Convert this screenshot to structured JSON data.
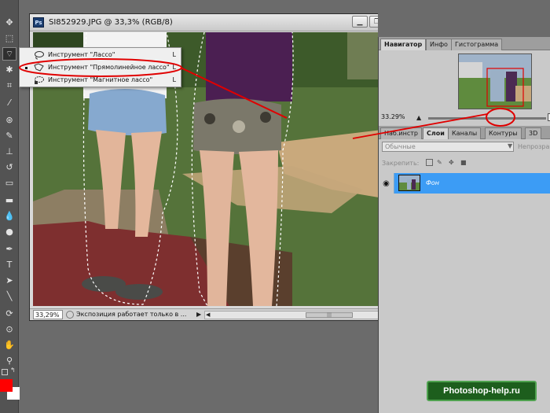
{
  "document": {
    "title": "SI852929.JPG @ 33,3% (RGB/8)",
    "app_badge": "Ps",
    "zoom": "33,29%",
    "status": "Экспозиция работает только в ...",
    "buttons": {
      "minimize": "▁",
      "maximize": "❐",
      "close": "✕"
    }
  },
  "flyout": {
    "items": [
      {
        "label": "Инструмент \"Лассо\"",
        "key": "L",
        "icon": "lasso-icon"
      },
      {
        "label": "Инструмент \"Прямолинейное лассо\"",
        "key": "L",
        "icon": "polygonal-lasso-icon",
        "selected": true
      },
      {
        "label": "Инструмент \"Магнитное лассо\"",
        "key": "L",
        "icon": "magnetic-lasso-icon"
      }
    ]
  },
  "navigator": {
    "tabs": [
      "Навигатор",
      "Инфо",
      "Гистограмма"
    ],
    "zoom": "33.29%"
  },
  "layers": {
    "tabs": [
      "Наб.инстр",
      "Слои",
      "Каналы",
      "Контуры",
      "3D"
    ],
    "blend_mode": "Обычные",
    "opacity_label": "Непрозрачн",
    "lock_label": "Закрепить:",
    "layer_name": "Фон"
  },
  "watermark": "Photoshop-help.ru",
  "colors": {
    "foreground": "#ff0000",
    "background": "#ffffff",
    "layer_selected": "#3c9cf5",
    "annotation": "#e00000"
  }
}
